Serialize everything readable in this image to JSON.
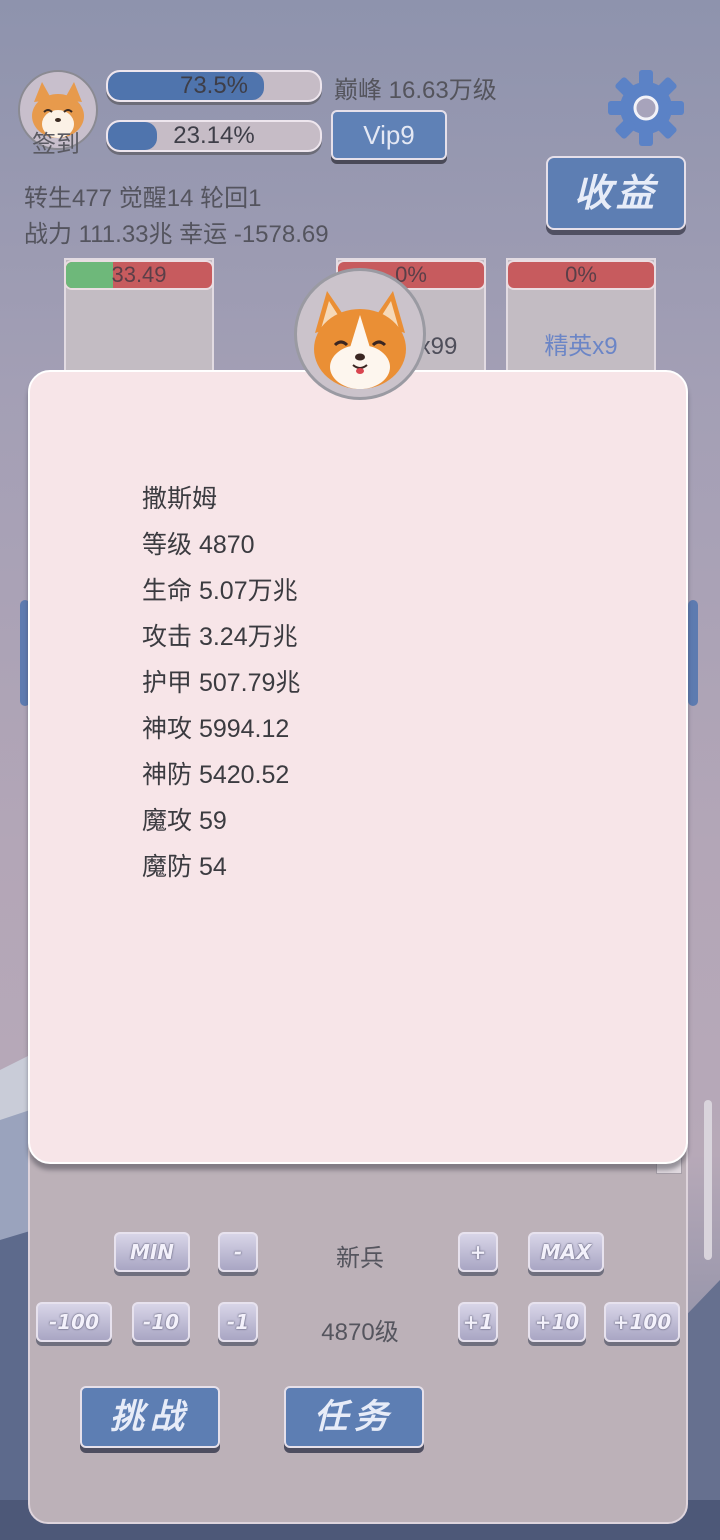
{
  "header": {
    "sign_in_label": "签到",
    "exp_bar": {
      "text": "73.5%",
      "fraction": 0.735
    },
    "second_bar": {
      "text": "23.14%",
      "fraction": 0.2314
    },
    "peak_text": "巅峰 16.63万级",
    "vip_label": "Vip9",
    "income_label": "收益",
    "stat_line1": "转生477 觉醒14 轮回1",
    "stat_line2": "战力 111.33兆  幸运 -1578.69"
  },
  "slots": [
    {
      "hp_text": "33.49",
      "hp_fraction": 0.32,
      "name": ""
    },
    {
      "hp_text": "0%",
      "hp_fraction": 0,
      "name": "怪x99"
    },
    {
      "hp_text": "0%",
      "hp_fraction": 0,
      "name": "精英x9"
    }
  ],
  "modal": {
    "lines": [
      "撒斯姆",
      "等级 4870",
      "生命 5.07万兆",
      "攻击 3.24万兆",
      "护甲 507.79兆",
      "神攻 5994.12",
      "神防 5420.52",
      "魔攻 59",
      "魔防 54"
    ]
  },
  "controls": {
    "min": "MIN",
    "minus": "-",
    "unit_label": "新兵",
    "plus": "+",
    "max": "MAX",
    "m100": "-100",
    "m10": "-10",
    "m1": "-1",
    "level_label": "4870级",
    "p1": "+1",
    "p10": "+10",
    "p100": "+100",
    "challenge": "挑战",
    "tasks": "任务"
  },
  "colors": {
    "accent_blue": "#5d7eb3",
    "hp_red": "#c75b5e",
    "hp_green": "#6eb87a",
    "modal_bg": "#f7e5e8"
  }
}
